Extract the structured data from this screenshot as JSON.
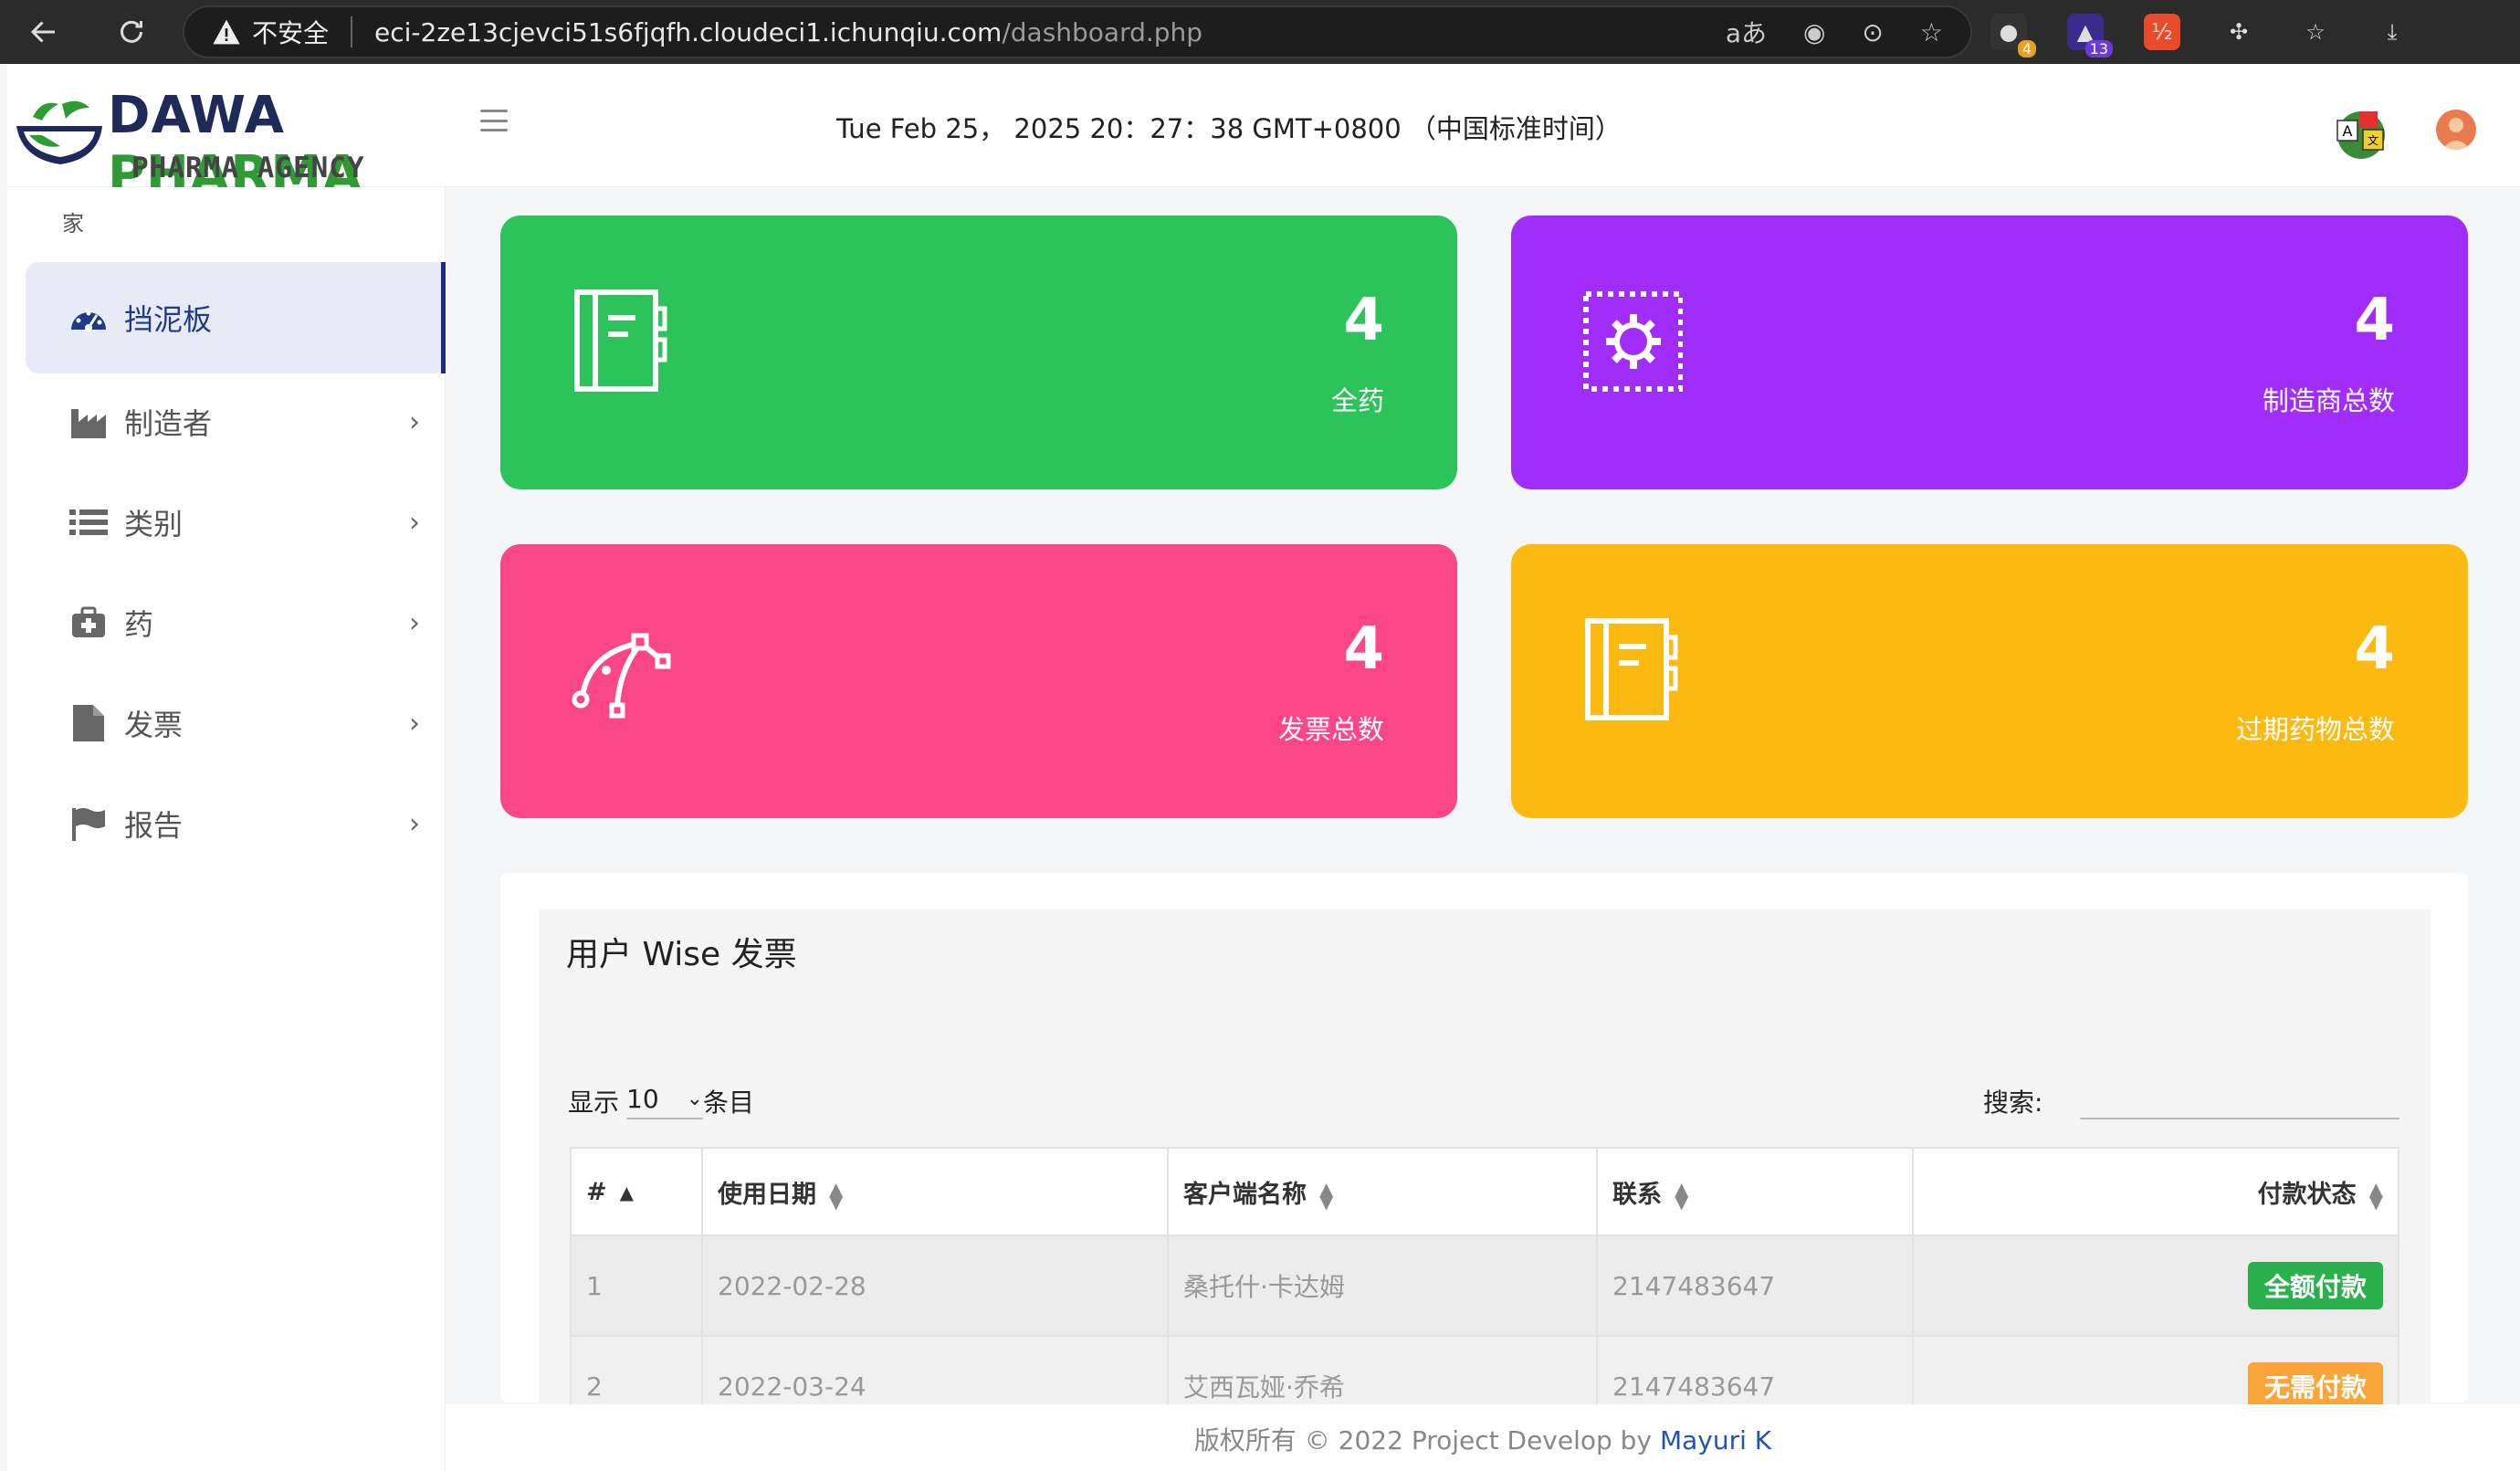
{
  "browser": {
    "security_label": "不安全",
    "url_host": "eci-2ze13cjevci51s6fjqfh.cloudeci1.ichunqiu.com",
    "url_path": "/dashboard.php",
    "ext_badge_1": "4",
    "ext_badge_2": "13"
  },
  "header": {
    "logo_dawa": "DAWA",
    "logo_pharma": "PHARMA",
    "logo_sub": "PHARMA AGENCY SOFTWARE",
    "datetime": "Tue Feb 25， 2025 20：27：38 GMT+0800 （中国标准时间）"
  },
  "sidebar": {
    "heading": "家",
    "items": [
      {
        "label": "挡泥板",
        "icon": "dashboard-icon"
      },
      {
        "label": "制造者",
        "icon": "industry-icon"
      },
      {
        "label": "类别",
        "icon": "list-icon"
      },
      {
        "label": "药",
        "icon": "medkit-icon"
      },
      {
        "label": "发票",
        "icon": "file-icon"
      },
      {
        "label": "报告",
        "icon": "flag-icon"
      }
    ]
  },
  "cards": [
    {
      "value": "4",
      "label": "全药",
      "color": "#2cc45a",
      "icon": "notebook-icon"
    },
    {
      "value": "4",
      "label": "制造商总数",
      "color": "#a12dfb",
      "icon": "gear-icon"
    },
    {
      "value": "4",
      "label": "发票总数",
      "color": "#fb4688",
      "icon": "vector-pen-icon"
    },
    {
      "value": "4",
      "label": "过期药物总数",
      "color": "#fcba10",
      "icon": "notebook-icon"
    }
  ],
  "table_panel": {
    "title": "用户 Wise 发票",
    "show_label": "显示",
    "show_value": "10",
    "entries_label": "条目",
    "search_label": "搜索:",
    "columns": [
      "#",
      "使用日期",
      "客户端名称",
      "联系",
      "付款状态"
    ],
    "rows": [
      {
        "num": "1",
        "date": "2022-02-28",
        "client": "桑托什·卡达姆",
        "contact": "2147483647",
        "status": "全额付款",
        "status_color": "#2bb04d"
      },
      {
        "num": "2",
        "date": "2022-03-24",
        "client": "艾西瓦娅·乔希",
        "contact": "2147483647",
        "status": "无需付款",
        "status_color": "#f9a53a"
      }
    ]
  },
  "footer": {
    "text": "版权所有 © 2022 Project Develop by",
    "author": "Mayuri K"
  }
}
